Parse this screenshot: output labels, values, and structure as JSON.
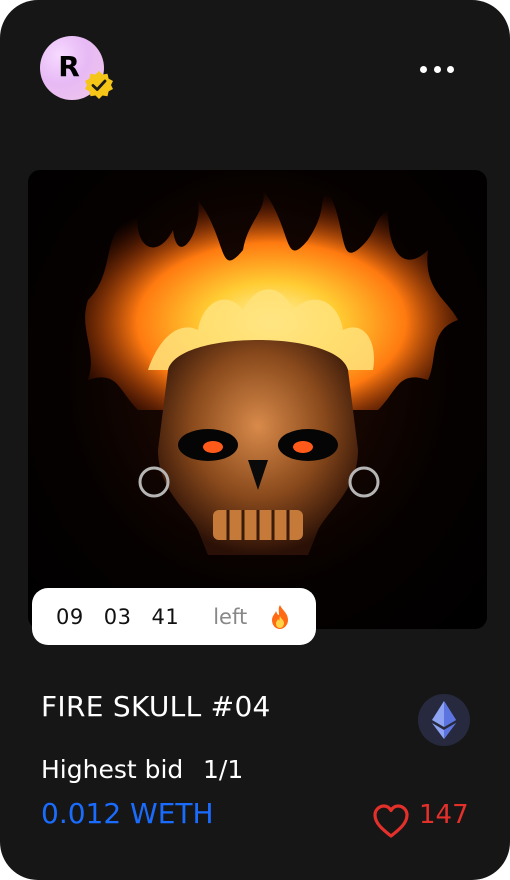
{
  "creator": {
    "avatar_letter": "R"
  },
  "timer": {
    "hours": "09",
    "minutes": "03",
    "seconds": "41",
    "suffix": "left"
  },
  "nft": {
    "title": "FIRE SKULL #04",
    "bid_label": "Highest bid",
    "edition": "1/1",
    "price": "0.012 WETH",
    "likes": "147"
  },
  "icons": {
    "verified": "verified-badge-icon",
    "more": "more-dots-icon",
    "fire": "fire-emoji-icon",
    "currency": "ethereum-icon",
    "like": "heart-icon"
  },
  "colors": {
    "card": "#161616",
    "price": "#1a6cff",
    "likes": "#e3302b",
    "verified": "#f5c518"
  }
}
